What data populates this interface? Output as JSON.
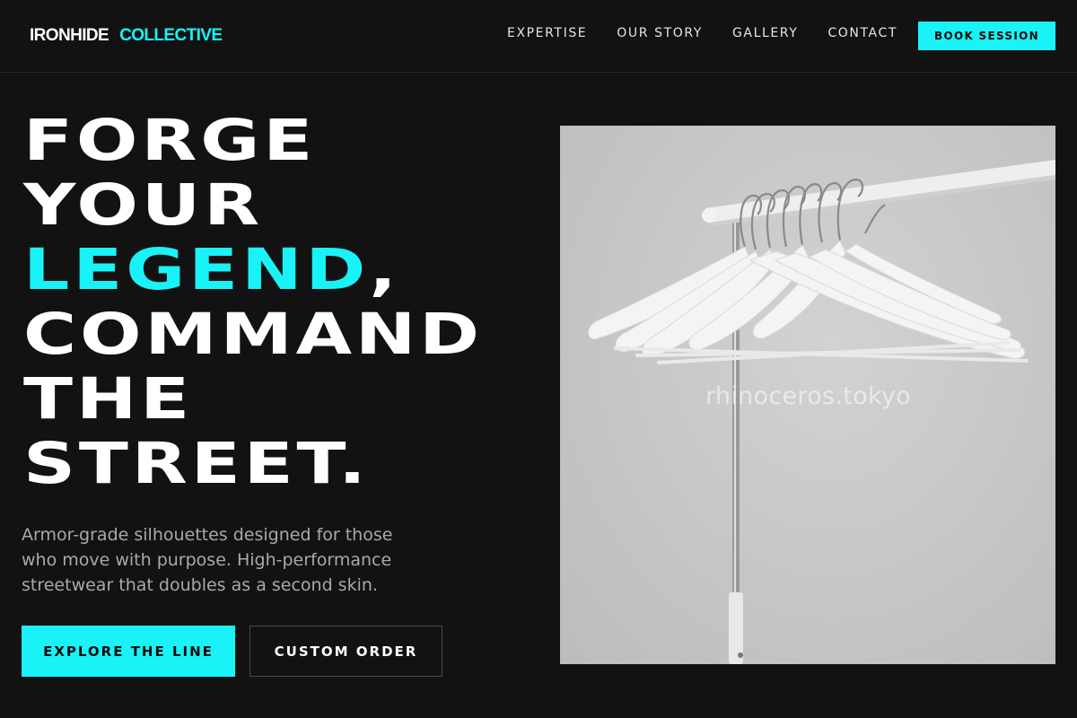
{
  "brand": {
    "name_part1": "IRONHIDE",
    "name_part2": "COLLECTIVE"
  },
  "nav": {
    "links": [
      "EXPERTISE",
      "OUR STORY",
      "GALLERY",
      "CONTACT"
    ],
    "cta_label": "BOOK SESSION"
  },
  "hero": {
    "headline": {
      "line1": "FORGE",
      "line2": "YOUR",
      "line3_accent": "LEGEND",
      "line3_rest": ",",
      "line4": "COMMAND",
      "line5": "THE",
      "line6": "STREET."
    },
    "subtext": "Armor-grade silhouettes designed for those who move with purpose. High-performance streetwear that doubles as a second skin.",
    "primary_button": "EXPLORE THE LINE",
    "secondary_button": "CUSTOM ORDER"
  },
  "image": {
    "watermark": "rhinoceros.tokyo"
  },
  "colors": {
    "accent": "#19f3f7",
    "background": "#121212",
    "text": "#ffffff",
    "muted_text": "#a9a9a9"
  }
}
